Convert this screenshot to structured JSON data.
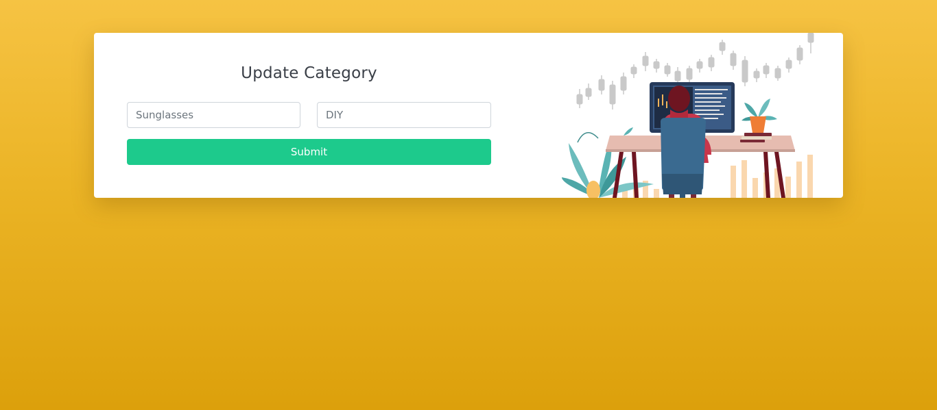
{
  "form": {
    "title": "Update Category",
    "category_name_value": "Sunglasses",
    "category_description_value": "DIY",
    "submit_label": "Submit"
  },
  "illustration": {
    "icon": "person-at-desk-trading-illustration"
  },
  "colors": {
    "background_top": "#f6c343",
    "background_bottom": "#dca00b",
    "submit_button": "#1dca8c"
  }
}
